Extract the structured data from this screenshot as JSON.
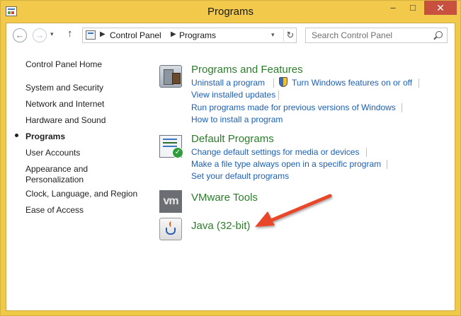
{
  "window": {
    "title": "Programs",
    "controls": {
      "minimize": "–",
      "maximize": "□",
      "close": "✕"
    }
  },
  "address_bar": {
    "breadcrumbs": [
      "Control Panel",
      "Programs"
    ],
    "search_placeholder": "Search Control Panel"
  },
  "left_nav": {
    "home": "Control Panel Home",
    "items": [
      {
        "label": "System and Security"
      },
      {
        "label": "Network and Internet"
      },
      {
        "label": "Hardware and Sound"
      },
      {
        "label": "Programs",
        "current": true
      },
      {
        "label": "User Accounts"
      },
      {
        "label": "Appearance and Personalization"
      },
      {
        "label": "Clock, Language, and Region"
      },
      {
        "label": "Ease of Access"
      }
    ]
  },
  "sections": {
    "programs_features": {
      "title": "Programs and Features",
      "links": [
        "Uninstall a program",
        "Turn Windows features on or off",
        "View installed updates",
        "Run programs made for previous versions of Windows",
        "How to install a program"
      ]
    },
    "default_programs": {
      "title": "Default Programs",
      "links": [
        "Change default settings for media or devices",
        "Make a file type always open in a specific program",
        "Set your default programs"
      ]
    },
    "vmware": {
      "title": "VMware Tools",
      "icon_text": "vm"
    },
    "java": {
      "title": "Java (32-bit)"
    }
  },
  "colors": {
    "title_bar": "#f2c94a",
    "section_title": "#2a7e2a",
    "link": "#1b5fb5",
    "annotation_arrow": "#e8462a"
  },
  "icons": {
    "app": "control-panel-icon",
    "search": "search-icon",
    "shield": "uac-shield-icon",
    "arrow": "red-arrow-annotation"
  }
}
